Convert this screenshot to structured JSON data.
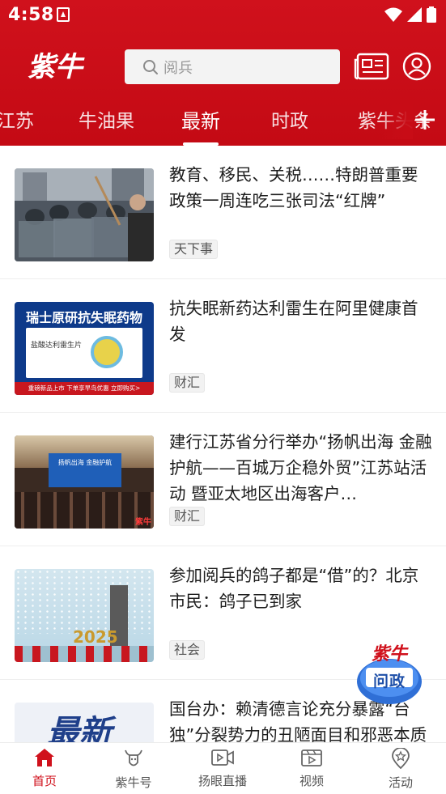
{
  "status_bar": {
    "time": "4:58"
  },
  "header": {
    "logo_text": "紫牛",
    "search_placeholder": "阅兵",
    "icons": [
      "search-icon",
      "newspaper-icon",
      "user-icon"
    ]
  },
  "tabs": {
    "items": [
      "江苏",
      "牛油果",
      "最新",
      "时政",
      "紫牛头条"
    ],
    "active": "最新"
  },
  "feed": [
    {
      "title": "教育、移民、关税……特朗普重要政策一周连吃三张司法“红牌”",
      "tag": "天下事"
    },
    {
      "title": "抗失眠新药达利雷生在阿里健康首发",
      "tag": "财汇",
      "thumb_text": {
        "headline": "瑞士原研抗失眠药物",
        "product": "盐酸达利雷生片",
        "banner": "重磅新品上市  下单享早鸟优惠  立即购买>"
      }
    },
    {
      "title": "建行江苏省分行举办“扬帆出海 金融护航——百城万企稳外贸”江苏站活动 暨亚太地区出海客户…",
      "tag": "财汇",
      "thumb_text": {
        "screen": "扬帆出海 金融护航",
        "watermark": "紫牛"
      }
    },
    {
      "title": "参加阅兵的鸽子都是“借”的？北京市民：鸽子已到家",
      "tag": "社会",
      "thumb_text": {
        "year": "2025"
      }
    },
    {
      "title": "国台办：赖清德言论充分暴露“台独”分裂势力的丑陋面目和邪恶本质",
      "tag": "",
      "thumb_text": {
        "label": "最新"
      }
    }
  ],
  "float_badge": {
    "line1": "紫牛",
    "line2": "问政"
  },
  "bottom_nav": [
    {
      "label": "首页",
      "icon": "home-icon",
      "active": true
    },
    {
      "label": "紫牛号",
      "icon": "ox-icon",
      "active": false
    },
    {
      "label": "扬眼直播",
      "icon": "live-video-icon",
      "active": false
    },
    {
      "label": "视频",
      "icon": "video-icon",
      "active": false
    },
    {
      "label": "活动",
      "icon": "activity-pin-icon",
      "active": false
    }
  ],
  "colors": {
    "brand_red": "#d0111c",
    "text": "#1e1e1e",
    "tag_bg": "#f2f2f2"
  }
}
